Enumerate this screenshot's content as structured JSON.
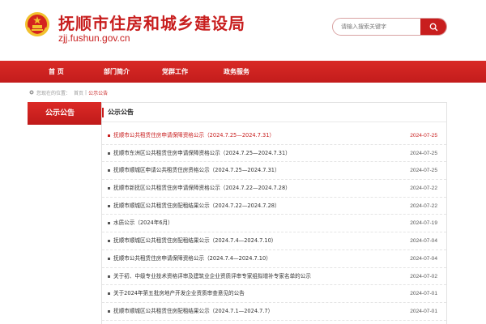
{
  "header": {
    "site_title": "抚顺市住房和城乡建设局",
    "site_domain": "zjj.fushun.gov.cn",
    "search_placeholder": "请输入搜索关键字"
  },
  "nav": {
    "items": [
      {
        "label": "首  页"
      },
      {
        "label": "部门简介"
      },
      {
        "label": "党群工作"
      },
      {
        "label": "政务服务"
      }
    ]
  },
  "breadcrumb": {
    "prefix": "您现在的位置：",
    "home": "首页",
    "separator": "|",
    "current": "公示公告"
  },
  "sidebar": {
    "active_tab": "公示公告"
  },
  "panel": {
    "title": "公示公告",
    "items": [
      {
        "title": "抚顺市公共租赁住房申请保障资格公示（2024.7.25—2024.7.31）",
        "date": "2024-07-25"
      },
      {
        "title": "抚顺市东洲区公共租赁住房申请保障资格公示（2024.7.25—2024.7.31）",
        "date": "2024-07-25"
      },
      {
        "title": "抚顺市顺城区申请公共租赁住房资格公示（2024.7.25—2024.7.31）",
        "date": "2024-07-25"
      },
      {
        "title": "抚顺市新抚区公共租赁住房申请保障资格公示（2024.7.22—2024.7.28）",
        "date": "2024-07-22"
      },
      {
        "title": "抚顺市顺城区公共租赁住房配租结果公示（2024.7.22—2024.7.28）",
        "date": "2024-07-22"
      },
      {
        "title": "水质公示（2024年6月）",
        "date": "2024-07-19"
      },
      {
        "title": "抚顺市顺城区公共租赁住房配租结果公示（2024.7.4—2024.7.10）",
        "date": "2024-07-04"
      },
      {
        "title": "抚顺市公共租赁住房申请保障资格公示（2024.7.4—2024.7.10）",
        "date": "2024-07-04"
      },
      {
        "title": "关于初、中级专业技术资格评审及建筑业企业资质评审专家组拟增补专家名单的公示",
        "date": "2024-07-02"
      },
      {
        "title": "关于2024年第五批房地产开发企业资质审查意见的公告",
        "date": "2024-07-01"
      },
      {
        "title": "抚顺市顺城区公共租赁住房配租结果公示（2024.7.1—2024.7.7）",
        "date": "2024-07-01"
      }
    ]
  },
  "colors": {
    "brand_red": "#c81e1e",
    "gold": "#f2c12e"
  },
  "icons": {
    "emblem": "national-emblem-icon",
    "search": "search-icon"
  }
}
